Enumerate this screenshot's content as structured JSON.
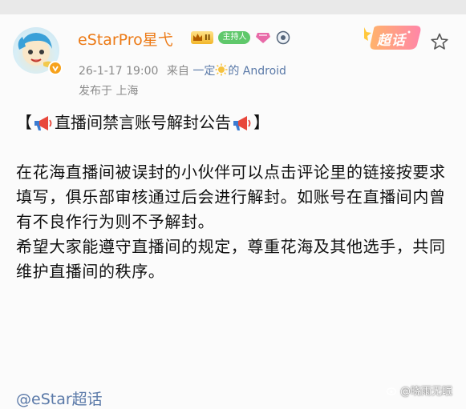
{
  "post": {
    "username": "eStarPro星弋",
    "level": "II",
    "host_badge": "主持人",
    "time": "26-1-17 19:00",
    "from_label": "来自",
    "source_prefix": "一定",
    "source_suffix": "的 Android",
    "location": "发布于 上海",
    "chaohua_label": "超话",
    "announcement_open": "【",
    "announcement_title": "直播间禁言账号解封公告",
    "announcement_close": "】",
    "paragraph_1": "在花海直播间被误封的小伙伴可以点击评论里的链接按要求填写，俱乐部审核通过后会进行解封。如账号在直播间内曾有不良作行为则不予解封。",
    "paragraph_2": "希望大家能遵守直播间的规定，尊重花海及其他选手，共同维护直播间的秩序。",
    "topic_link": "@eStar超话"
  },
  "watermark": "@晓雨无眠",
  "colors": {
    "username": "#ec7a16",
    "link": "#5a79a8",
    "meta": "#8a8a8a",
    "host_badge": "#5fc86b"
  }
}
